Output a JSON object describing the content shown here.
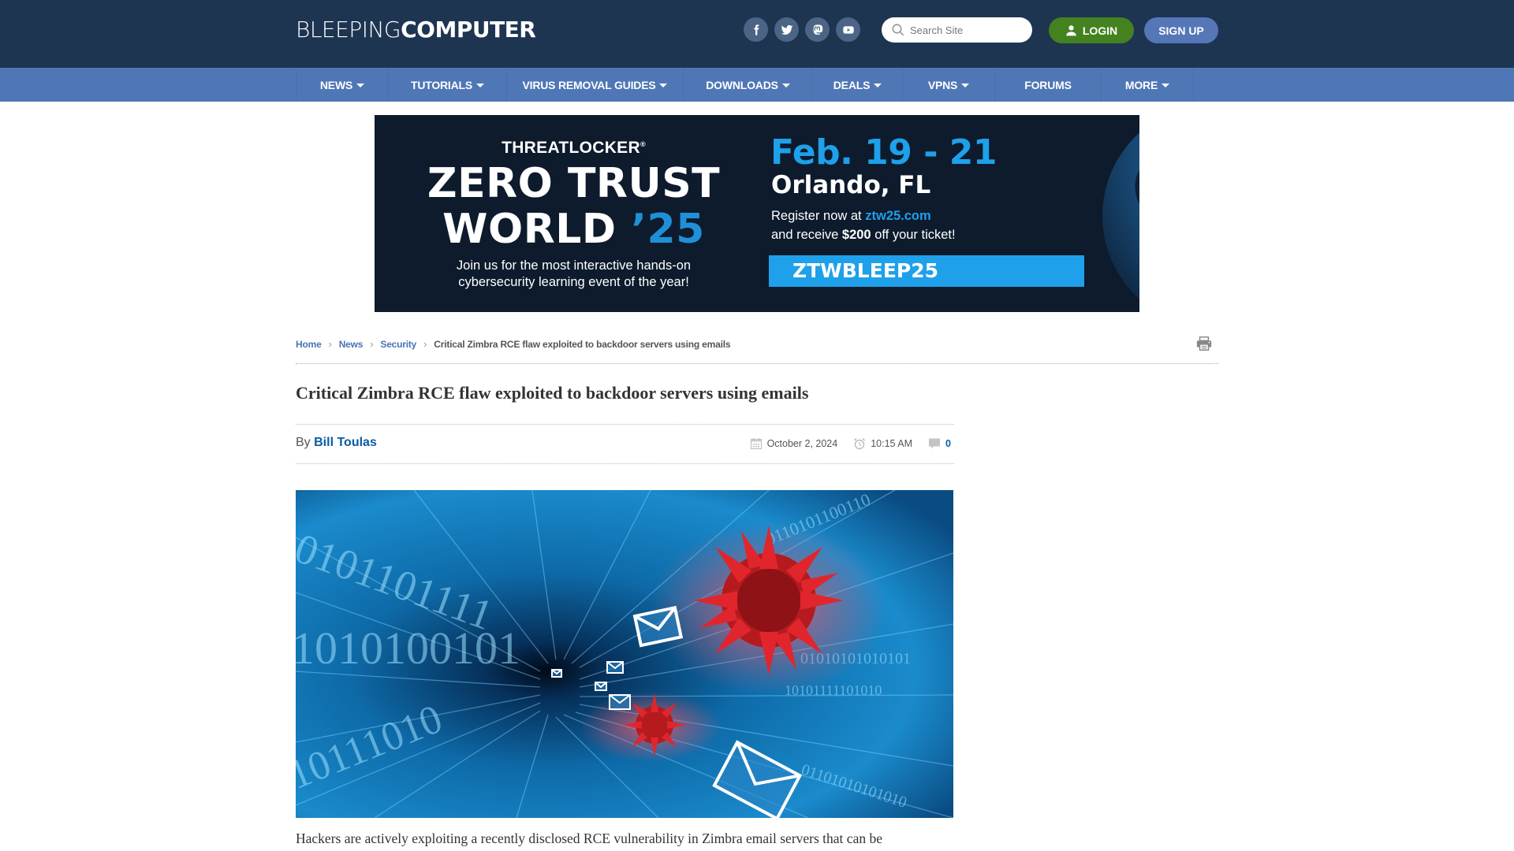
{
  "header": {
    "logo_light": "BLEEPING",
    "logo_bold": "COMPUTER",
    "social": [
      {
        "name": "facebook",
        "icon": "facebook-icon"
      },
      {
        "name": "twitter",
        "icon": "twitter-icon"
      },
      {
        "name": "mastodon",
        "icon": "mastodon-icon"
      },
      {
        "name": "youtube",
        "icon": "youtube-icon"
      }
    ],
    "search_placeholder": "Search Site",
    "login_label": "LOGIN",
    "signup_label": "SIGN UP"
  },
  "nav": {
    "items": [
      {
        "label": "NEWS",
        "dropdown": true
      },
      {
        "label": "TUTORIALS",
        "dropdown": true
      },
      {
        "label": "VIRUS REMOVAL GUIDES",
        "dropdown": true
      },
      {
        "label": "DOWNLOADS",
        "dropdown": true
      },
      {
        "label": "DEALS",
        "dropdown": true
      },
      {
        "label": "VPNS",
        "dropdown": true
      },
      {
        "label": "FORUMS",
        "dropdown": false
      },
      {
        "label": "MORE",
        "dropdown": true
      }
    ]
  },
  "ad": {
    "brand": "THREATLOCKER",
    "registered": "®",
    "line1_a": "Z",
    "line1_b": "E",
    "line1_c": "RO TRUST",
    "line2_a": "WORLD ",
    "line2_b": "’25",
    "tagline_1": "Join us for the most interactive hands-on",
    "tagline_2": "cybersecurity learning event of the year!",
    "dates": "Feb. 19 - 21",
    "city": "Orlando, FL",
    "register_prefix": "Register now at ",
    "register_link": "ztw25.com",
    "receive_prefix": "and receive ",
    "discount": "$200",
    "receive_suffix": " off your ticket!",
    "promo_code": "ZTWBLEEP25",
    "colors": {
      "background": "#0d1b2c",
      "accent": "#1ea0ea"
    }
  },
  "breadcrumb": {
    "items": [
      "Home",
      "News",
      "Security"
    ],
    "current": "Critical Zimbra RCE flaw exploited to backdoor servers using emails"
  },
  "article": {
    "title": "Critical Zimbra RCE flaw exploited to backdoor servers using emails",
    "by_label": "By ",
    "author": "Bill Toulas",
    "date": "October 2, 2024",
    "time": "10:15 AM",
    "comments": "0",
    "hero_alt": "Binary tunnel with emails and red virus particles",
    "lead": "Hackers are actively exploiting a recently disclosed RCE vulnerability in Zimbra email servers that can be"
  },
  "colors": {
    "header_bg": "#1d3551",
    "nav_bg": "#5077b5",
    "login_bg": "#44821f",
    "signup_bg": "#5577b8",
    "link": "#0a5ba3"
  }
}
